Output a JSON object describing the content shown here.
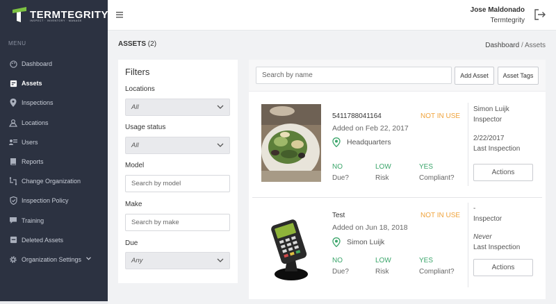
{
  "brand": {
    "name": "TERMTEGRITY",
    "tagline": "INSPECT · INVENTORY · MANAGE"
  },
  "sidebar": {
    "menu_label": "MENU",
    "items": [
      {
        "label": "Dashboard",
        "icon": "palette-icon"
      },
      {
        "label": "Assets",
        "icon": "box-icon",
        "active": true
      },
      {
        "label": "Inspections",
        "icon": "map-pin-icon"
      },
      {
        "label": "Locations",
        "icon": "location-icon"
      },
      {
        "label": "Users",
        "icon": "users-icon"
      },
      {
        "label": "Reports",
        "icon": "book-icon"
      },
      {
        "label": "Change Organization",
        "icon": "swap-icon"
      },
      {
        "label": "Inspection Policy",
        "icon": "shield-icon"
      },
      {
        "label": "Training",
        "icon": "chat-icon"
      },
      {
        "label": "Deleted Assets",
        "icon": "trash-box-icon"
      },
      {
        "label": "Organization Settings",
        "icon": "gear-icon",
        "has_caret": true
      }
    ]
  },
  "header": {
    "user_name": "Jose Maldonado",
    "user_org": "Termtegrity"
  },
  "page": {
    "title": "ASSETS",
    "count": "(2)",
    "breadcrumb": {
      "parent": "Dashboard",
      "separator": "/",
      "current": "Assets"
    }
  },
  "filters": {
    "title": "Filters",
    "locations_label": "Locations",
    "locations_value": "All",
    "usage_label": "Usage status",
    "usage_value": "All",
    "model_label": "Model",
    "model_placeholder": "Search by model",
    "make_label": "Make",
    "make_placeholder": "Search by make",
    "due_label": "Due",
    "due_value": "Any"
  },
  "toolbar": {
    "search_placeholder": "Search by name",
    "add_asset_label": "Add Asset",
    "asset_tags_label": "Asset Tags"
  },
  "assets": [
    {
      "id": "5411788041164",
      "added": "Added on Feb 22, 2017",
      "status": "NOT IN USE",
      "location": "Headquarters",
      "due_value": "NO",
      "due_label": "Due?",
      "risk_value": "LOW",
      "risk_label": "Risk",
      "compliant_value": "YES",
      "compliant_label": "Compliant?",
      "inspector_name": "Simon Luijk",
      "inspector_label": "Inspector",
      "last_inspection_value": "2/22/2017",
      "last_inspection_label": "Last Inspection",
      "actions_label": "Actions"
    },
    {
      "id": "Test",
      "added": "Added on Jun 18, 2018",
      "status": "NOT IN USE",
      "location": "Simon Luijk",
      "due_value": "NO",
      "due_label": "Due?",
      "risk_value": "LOW",
      "risk_label": "Risk",
      "compliant_value": "YES",
      "compliant_label": "Compliant?",
      "inspector_name": "-",
      "inspector_label": "Inspector",
      "last_inspection_value": "Never",
      "last_inspection_label": "Last Inspection",
      "actions_label": "Actions"
    }
  ],
  "colors": {
    "sidebar_bg": "#2c3241",
    "brand_green": "#7cc242",
    "status_orange": "#f0a33b",
    "metric_green": "#3aa56a"
  }
}
